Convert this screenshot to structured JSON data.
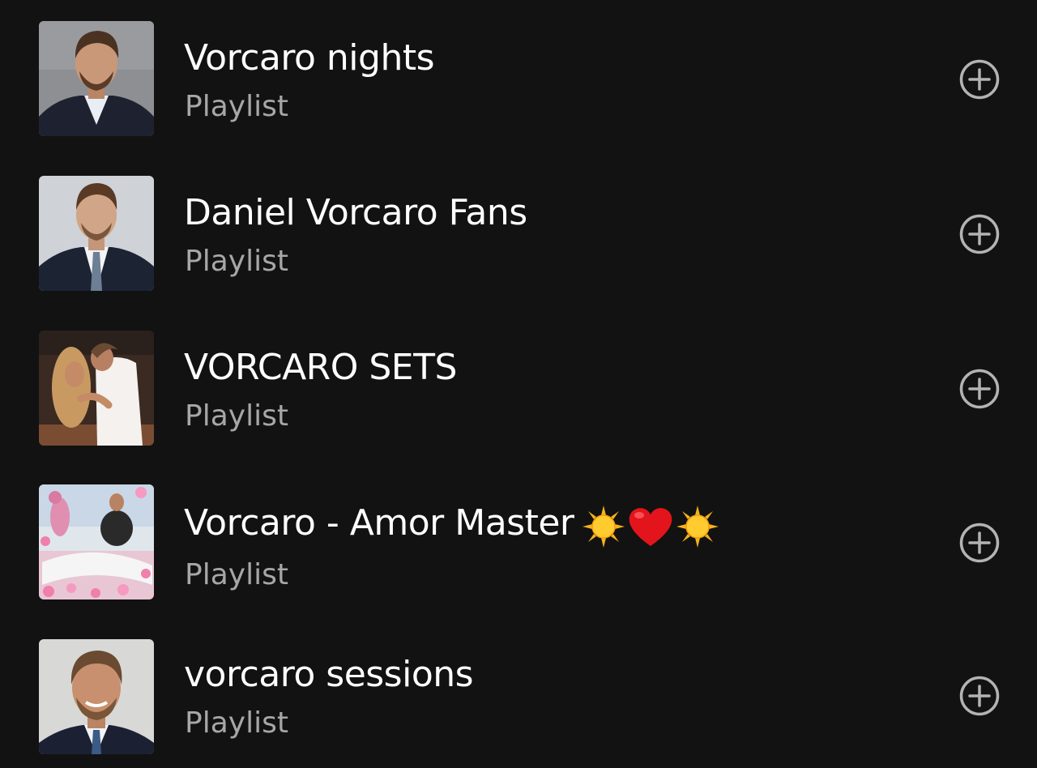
{
  "playlists": [
    {
      "title": "Vorcaro nights",
      "subtitle": "Playlist",
      "thumb_colors": {
        "bg": "#8e8f93",
        "suit": "#1e2230",
        "skin": "#c89878",
        "hair": "#4a3222",
        "shirt": "#e8eef4"
      },
      "title_emojis": []
    },
    {
      "title": "Daniel Vorcaro Fans",
      "subtitle": "Playlist",
      "thumb_colors": {
        "bg": "#cfd2d6",
        "suit": "#1c2333",
        "skin": "#d1a587",
        "hair": "#5a3a25",
        "shirt": "#f2f4f7"
      },
      "title_emojis": []
    },
    {
      "title": "VORCARO SETS",
      "subtitle": "Playlist",
      "thumb_colors": {
        "bg": "#3a2a22",
        "suit": "#f4f1ee",
        "skin": "#c48b66",
        "hair": "#6a4a32",
        "shirt": "#e9d3b4"
      },
      "title_emojis": []
    },
    {
      "title": "Vorcaro - Amor Master",
      "subtitle": "Playlist",
      "thumb_colors": {
        "bg": "#e9c6d3",
        "suit": "#2a2a2a",
        "skin": "#b98262",
        "hair": "#3a2a20",
        "shirt": "#f3dce6"
      },
      "title_emojis": [
        "sun-emoji",
        "red-heart-emoji",
        "sun-emoji"
      ]
    },
    {
      "title": "vorcaro sessions",
      "subtitle": "Playlist",
      "thumb_colors": {
        "bg": "#d8d8d6",
        "suit": "#1b2133",
        "skin": "#c8906e",
        "hair": "#6a4a30",
        "shirt": "#f1f3f6"
      },
      "title_emojis": []
    }
  ],
  "colors": {
    "background": "#121212",
    "title": "#ffffff",
    "subtitle": "#a7a7a7",
    "add_icon": "#b3b3b3"
  },
  "icons": {
    "add": "plus-circle-icon"
  }
}
